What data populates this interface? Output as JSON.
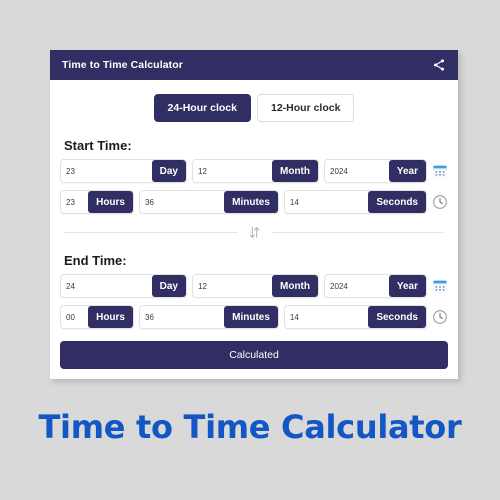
{
  "app": {
    "header_title": "Time to Time Calculator",
    "share_icon": "share-icon",
    "bottom_title": "Time to Time Calculator",
    "accent_navy": "#302e62",
    "page_bg": "#d9d9d9",
    "title_blue": "#1257c4"
  },
  "clock_toggle": {
    "options": [
      {
        "label": "24-Hour clock",
        "selected": true
      },
      {
        "label": "12-Hour clock",
        "selected": false
      }
    ]
  },
  "start_time": {
    "heading": "Start Time:",
    "date_row": {
      "day": {
        "value": "23",
        "tag": "Day"
      },
      "month": {
        "value": "12",
        "tag": "Month"
      },
      "year": {
        "value": "2024",
        "tag": "Year"
      },
      "trailing_icon": "calendar-icon"
    },
    "time_row": {
      "hours": {
        "value": "23",
        "tag": "Hours"
      },
      "minutes": {
        "value": "36",
        "tag": "Minutes"
      },
      "seconds": {
        "value": "14",
        "tag": "Seconds"
      },
      "trailing_icon": "clock-icon"
    }
  },
  "swap": {
    "icon": "swap-vertical-icon"
  },
  "end_time": {
    "heading": "End Time:",
    "date_row": {
      "day": {
        "value": "24",
        "tag": "Day"
      },
      "month": {
        "value": "12",
        "tag": "Month"
      },
      "year": {
        "value": "2024",
        "tag": "Year"
      },
      "trailing_icon": "calendar-icon"
    },
    "time_row": {
      "hours": {
        "value": "00",
        "tag": "Hours"
      },
      "minutes": {
        "value": "36",
        "tag": "Minutes"
      },
      "seconds": {
        "value": "14",
        "tag": "Seconds"
      },
      "trailing_icon": "clock-icon"
    }
  },
  "actions": {
    "calculate_label": "Calculated"
  }
}
